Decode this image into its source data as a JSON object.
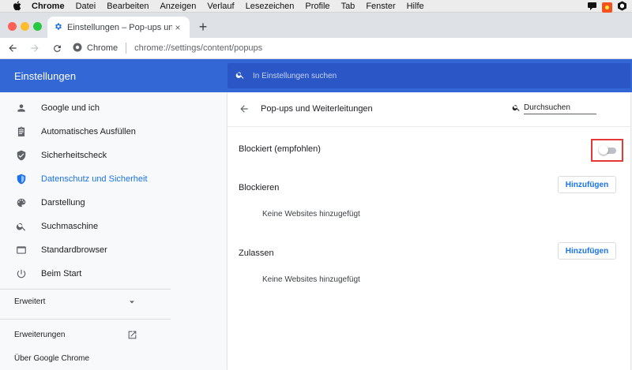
{
  "menubar": {
    "apple_icon": "apple-icon",
    "items": [
      "Chrome",
      "Datei",
      "Bearbeiten",
      "Anzeigen",
      "Verlauf",
      "Lesezeichen",
      "Profile",
      "Tab",
      "Fenster",
      "Hilfe"
    ],
    "tray_icons": [
      "notification-icon",
      "app-icon-orange",
      "hexagon-icon"
    ]
  },
  "tab": {
    "title": "Einstellungen – Pop-ups und W",
    "icon": "gear-icon",
    "close_glyph": "×"
  },
  "newtab_glyph": "+",
  "toolbar": {
    "site_label": "Chrome",
    "url": "chrome://settings/content/popups"
  },
  "settings": {
    "title": "Einstellungen",
    "search_placeholder": "In Einstellungen suchen"
  },
  "sidebar": {
    "items": [
      {
        "label": "Google und ich",
        "icon": "person-icon"
      },
      {
        "label": "Automatisches Ausfüllen",
        "icon": "clipboard-icon"
      },
      {
        "label": "Sicherheitscheck",
        "icon": "shield-check-icon"
      },
      {
        "label": "Datenschutz und Sicherheit",
        "icon": "shield-icon"
      },
      {
        "label": "Darstellung",
        "icon": "palette-icon"
      },
      {
        "label": "Suchmaschine",
        "icon": "search-icon"
      },
      {
        "label": "Standardbrowser",
        "icon": "browser-icon"
      },
      {
        "label": "Beim Start",
        "icon": "power-icon"
      }
    ],
    "active_index": 3,
    "advanced_label": "Erweitert",
    "extensions_label": "Erweiterungen",
    "about_label": "Über Google Chrome"
  },
  "page": {
    "title": "Pop-ups und Weiterleitungen",
    "search_placeholder": "Durchsuchen",
    "blocked_label": "Blockiert (empfohlen)",
    "toggle_on": false,
    "block_section": {
      "label": "Blockieren",
      "add_label": "Hinzufügen",
      "empty_text": "Keine Websites hinzugefügt"
    },
    "allow_section": {
      "label": "Zulassen",
      "add_label": "Hinzufügen",
      "empty_text": "Keine Websites hinzugefügt"
    }
  },
  "colors": {
    "header_blue": "#3367d6",
    "accent_blue": "#1a73e8",
    "highlight_red": "#e53935"
  }
}
